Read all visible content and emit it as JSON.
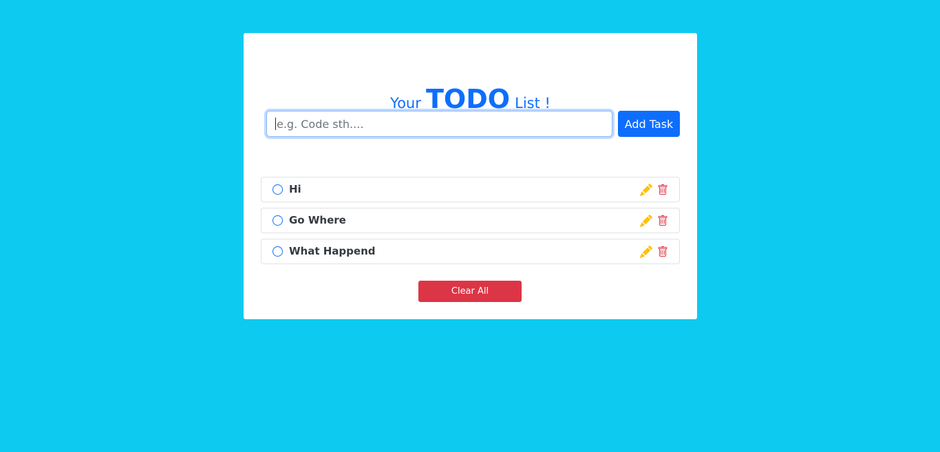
{
  "header": {
    "title_prefix": "Your",
    "title_main": "TODO",
    "title_suffix": "List !"
  },
  "input": {
    "placeholder": "e.g. Code sth....",
    "value": ""
  },
  "add_button": {
    "label": "Add Task"
  },
  "tasks": [
    {
      "label": "Hi",
      "status_icon": "circle-icon",
      "edit_icon": "pencil-icon",
      "delete_icon": "trash-icon"
    },
    {
      "label": "Go Where",
      "status_icon": "circle-icon",
      "edit_icon": "pencil-icon",
      "delete_icon": "trash-icon"
    },
    {
      "label": "What Happend",
      "status_icon": "circle-icon",
      "edit_icon": "pencil-icon",
      "delete_icon": "trash-icon"
    }
  ],
  "clear_button": {
    "label": "Clear All"
  },
  "colors": {
    "background": "#0dcaf0",
    "primary": "#0d6efd",
    "danger": "#dc3545",
    "warning": "#ffc107"
  }
}
